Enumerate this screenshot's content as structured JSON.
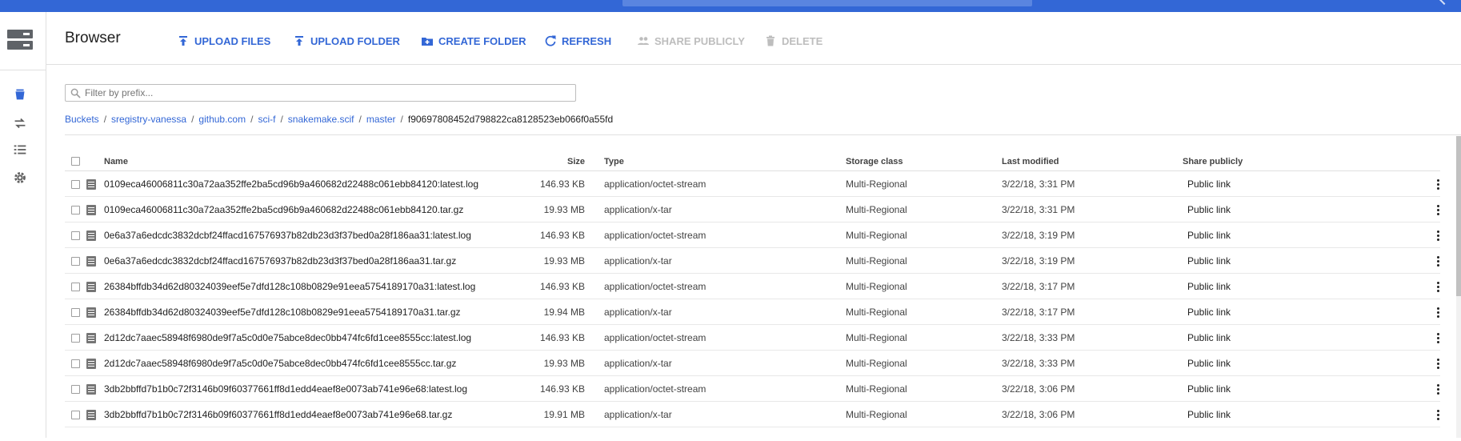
{
  "toolbar": {
    "title": "Browser",
    "buttons": [
      {
        "label": "UPLOAD FILES",
        "icon": "upload-icon",
        "enabled": true
      },
      {
        "label": "UPLOAD FOLDER",
        "icon": "upload-icon",
        "enabled": true
      },
      {
        "label": "CREATE FOLDER",
        "icon": "create-folder-icon",
        "enabled": true
      },
      {
        "label": "REFRESH",
        "icon": "refresh-icon",
        "enabled": true
      },
      {
        "label": "SHARE PUBLICLY",
        "icon": "people-icon",
        "enabled": false
      },
      {
        "label": "DELETE",
        "icon": "trash-icon",
        "enabled": false
      }
    ]
  },
  "filter": {
    "placeholder": "Filter by prefix..."
  },
  "breadcrumb": {
    "links": [
      "Buckets",
      "sregistry-vanessa",
      "github.com",
      "sci-f",
      "snakemake.scif",
      "master"
    ],
    "current": "f90697808452d798822ca8128523eb066f0a55fd"
  },
  "table": {
    "headers": {
      "name": "Name",
      "size": "Size",
      "type": "Type",
      "storage": "Storage class",
      "modified": "Last modified",
      "share": "Share publicly"
    },
    "rows": [
      {
        "name": "0109eca46006811c30a72aa352ffe2ba5cd96b9a460682d22488c061ebb84120:latest.log",
        "size": "146.93 KB",
        "type": "application/octet-stream",
        "storage": "Multi-Regional",
        "modified": "3/22/18, 3:31 PM",
        "share": "Public link"
      },
      {
        "name": "0109eca46006811c30a72aa352ffe2ba5cd96b9a460682d22488c061ebb84120.tar.gz",
        "size": "19.93 MB",
        "type": "application/x-tar",
        "storage": "Multi-Regional",
        "modified": "3/22/18, 3:31 PM",
        "share": "Public link"
      },
      {
        "name": "0e6a37a6edcdc3832dcbf24ffacd167576937b82db23d3f37bed0a28f186aa31:latest.log",
        "size": "146.93 KB",
        "type": "application/octet-stream",
        "storage": "Multi-Regional",
        "modified": "3/22/18, 3:19 PM",
        "share": "Public link"
      },
      {
        "name": "0e6a37a6edcdc3832dcbf24ffacd167576937b82db23d3f37bed0a28f186aa31.tar.gz",
        "size": "19.93 MB",
        "type": "application/x-tar",
        "storage": "Multi-Regional",
        "modified": "3/22/18, 3:19 PM",
        "share": "Public link"
      },
      {
        "name": "26384bffdb34d62d80324039eef5e7dfd128c108b0829e91eea5754189170a31:latest.log",
        "size": "146.93 KB",
        "type": "application/octet-stream",
        "storage": "Multi-Regional",
        "modified": "3/22/18, 3:17 PM",
        "share": "Public link"
      },
      {
        "name": "26384bffdb34d62d80324039eef5e7dfd128c108b0829e91eea5754189170a31.tar.gz",
        "size": "19.94 MB",
        "type": "application/x-tar",
        "storage": "Multi-Regional",
        "modified": "3/22/18, 3:17 PM",
        "share": "Public link"
      },
      {
        "name": "2d12dc7aaec58948f6980de9f7a5c0d0e75abce8dec0bb474fc6fd1cee8555cc:latest.log",
        "size": "146.93 KB",
        "type": "application/octet-stream",
        "storage": "Multi-Regional",
        "modified": "3/22/18, 3:33 PM",
        "share": "Public link"
      },
      {
        "name": "2d12dc7aaec58948f6980de9f7a5c0d0e75abce8dec0bb474fc6fd1cee8555cc.tar.gz",
        "size": "19.93 MB",
        "type": "application/x-tar",
        "storage": "Multi-Regional",
        "modified": "3/22/18, 3:33 PM",
        "share": "Public link"
      },
      {
        "name": "3db2bbffd7b1b0c72f3146b09f60377661ff8d1edd4eaef8e0073ab741e96e68:latest.log",
        "size": "146.93 KB",
        "type": "application/octet-stream",
        "storage": "Multi-Regional",
        "modified": "3/22/18, 3:06 PM",
        "share": "Public link"
      },
      {
        "name": "3db2bbffd7b1b0c72f3146b09f60377661ff8d1edd4eaef8e0073ab741e96e68.tar.gz",
        "size": "19.91 MB",
        "type": "application/x-tar",
        "storage": "Multi-Regional",
        "modified": "3/22/18, 3:06 PM",
        "share": "Public link"
      }
    ]
  },
  "colors": {
    "brand": "#3367d6",
    "disabled": "#bdbdbd"
  }
}
